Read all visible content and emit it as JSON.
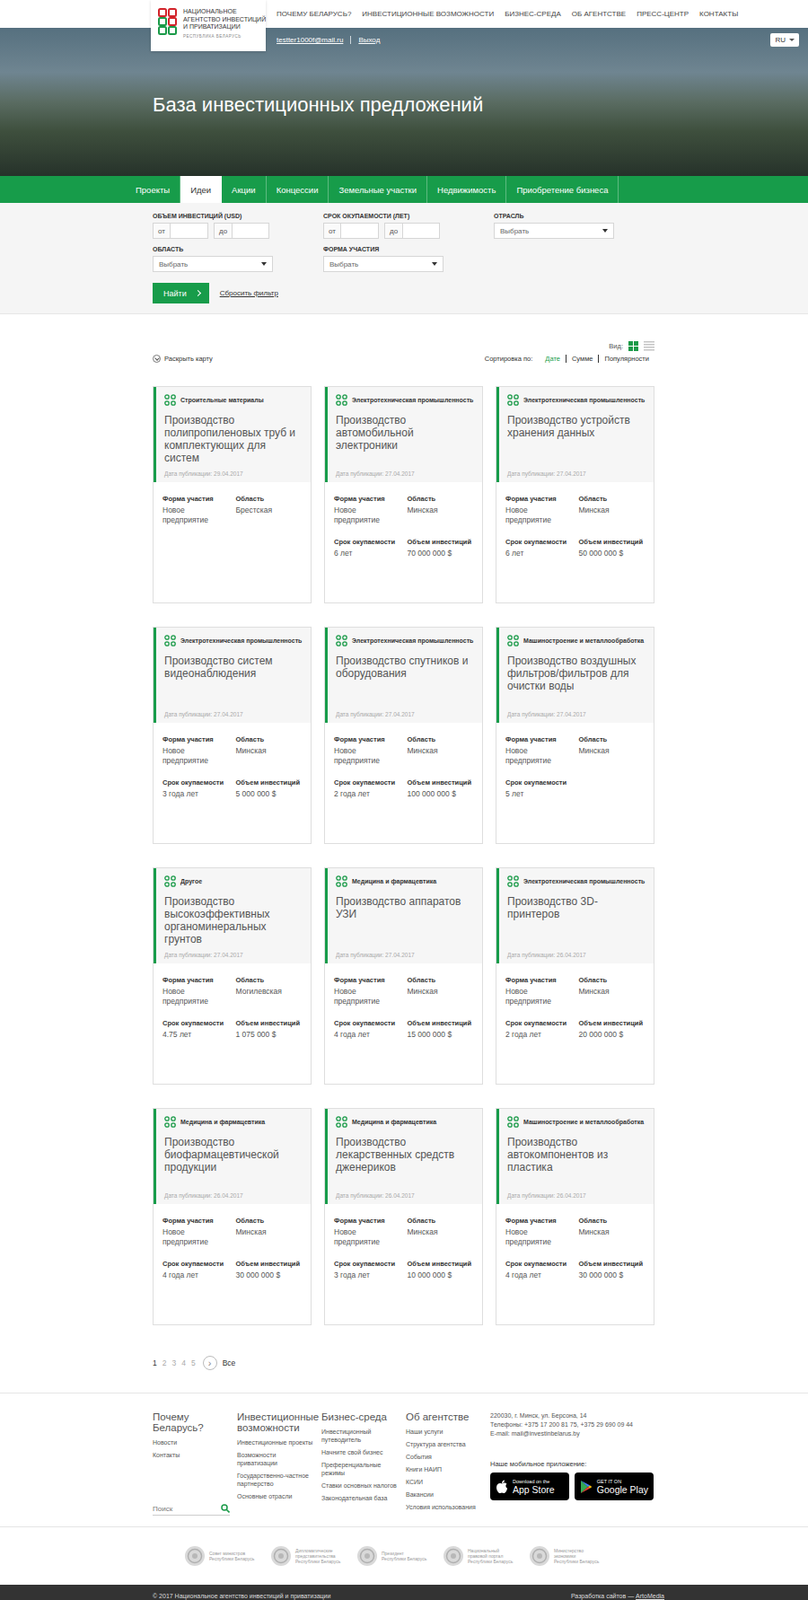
{
  "header": {
    "logo": {
      "lines": [
        "НАЦИОНАЛЬНОЕ",
        "АГЕНТСТВО ИНВЕСТИЦИЙ",
        "И ПРИВАТИЗАЦИИ"
      ],
      "sub": "РЕСПУБЛИКА БЕЛАРУСЬ"
    },
    "nav": [
      "ПОЧЕМУ БЕЛАРУСЬ?",
      "ИНВЕСТИЦИОННЫЕ ВОЗМОЖНОСТИ",
      "БИЗНЕС-СРЕДА",
      "ОБ АГЕНТСТВЕ",
      "ПРЕСС-ЦЕНТР",
      "КОНТАКТЫ"
    ]
  },
  "hero": {
    "email": "testter1000f@mail.ru",
    "logout": "Выход",
    "lang": "RU",
    "title": "База инвестиционных предложений"
  },
  "tabs": [
    {
      "label": "Проекты",
      "selected": false
    },
    {
      "label": "Идеи",
      "selected": true
    },
    {
      "label": "Акции",
      "selected": false
    },
    {
      "label": "Концессии",
      "selected": false
    },
    {
      "label": "Земельные участки",
      "selected": false
    },
    {
      "label": "Недвижимость",
      "selected": false
    },
    {
      "label": "Приобретение бизнеса",
      "selected": false
    }
  ],
  "filters": [
    {
      "label": "ОБЪЕМ ИНВЕСТИЦИЙ (USD)",
      "kind": "range",
      "from": "от",
      "to": "до"
    },
    {
      "label": "СРОК ОКУПАЕМОСТИ (ЛЕТ)",
      "kind": "range",
      "from": "от",
      "to": "до"
    },
    {
      "label": "ОТРАСЛЬ",
      "kind": "select",
      "placeholder": "Выбрать"
    },
    {
      "label": "ОБЛАСТЬ",
      "kind": "select",
      "placeholder": "Выбрать"
    },
    {
      "label": "ФОРМА УЧАСТИЯ",
      "kind": "select",
      "placeholder": "Выбрать"
    }
  ],
  "find_button": "Найти",
  "reset_link": "Сбросить фильтр",
  "map_toggle": "Раскрыть карту",
  "view": {
    "label": "Вид:",
    "modes": [
      {
        "kind": "grid",
        "selected": true
      },
      {
        "kind": "list",
        "selected": false
      }
    ]
  },
  "sort": {
    "label": "Сортировка по:",
    "options": [
      {
        "label": "Дате",
        "selected": true
      },
      {
        "label": "Сумме",
        "selected": false
      },
      {
        "label": "Популярности",
        "selected": false
      }
    ]
  },
  "cards": [
    {
      "category": "Строительные материалы",
      "title": "Производство полипропиленовых труб и комплектующих для систем",
      "date": "Дата публикации: 29.04.2017",
      "fields": [
        {
          "label": "Форма участия",
          "value": "Новое предприятие"
        },
        {
          "label": "Область",
          "value": "Брестская"
        }
      ]
    },
    {
      "category": "Электротехническая промышленность",
      "title": "Производство автомобильной электроники",
      "date": "Дата публикации: 27.04.2017",
      "fields": [
        {
          "label": "Форма участия",
          "value": "Новое предприятие"
        },
        {
          "label": "Область",
          "value": "Минская"
        },
        {
          "label": "Срок окупаемости",
          "value": "6 лет"
        },
        {
          "label": "Объем инвестиций",
          "value": "70 000 000 $"
        }
      ]
    },
    {
      "category": "Электротехническая промышленность",
      "title": "Производство устройств хранения данных",
      "date": "Дата публикации: 27.04.2017",
      "fields": [
        {
          "label": "Форма участия",
          "value": "Новое предприятие"
        },
        {
          "label": "Область",
          "value": "Минская"
        },
        {
          "label": "Срок окупаемости",
          "value": "6 лет"
        },
        {
          "label": "Объем инвестиций",
          "value": "50 000 000 $"
        }
      ]
    },
    {
      "category": "Электротехническая промышленность",
      "title": "Производство систем видеонаблюдения",
      "date": "Дата публикации: 27.04.2017",
      "fields": [
        {
          "label": "Форма участия",
          "value": "Новое предприятие"
        },
        {
          "label": "Область",
          "value": "Минская"
        },
        {
          "label": "Срок окупаемости",
          "value": "3 года лет"
        },
        {
          "label": "Объем инвестиций",
          "value": "5 000 000 $"
        }
      ]
    },
    {
      "category": "Электротехническая промышленность",
      "title": "Производство спутников и оборудования",
      "date": "Дата публикации: 27.04.2017",
      "fields": [
        {
          "label": "Форма участия",
          "value": "Новое предприятие"
        },
        {
          "label": "Область",
          "value": "Минская"
        },
        {
          "label": "Срок окупаемости",
          "value": "2 года лет"
        },
        {
          "label": "Объем инвестиций",
          "value": "100 000 000 $"
        }
      ]
    },
    {
      "category": "Машиностроение и металлообработка",
      "title": "Производство воздушных фильтров/фильтров для очистки воды",
      "date": "Дата публикации: 27.04.2017",
      "fields": [
        {
          "label": "Форма участия",
          "value": "Новое предприятие"
        },
        {
          "label": "Область",
          "value": "Минская"
        },
        {
          "label": "Срок окупаемости",
          "value": "5 лет"
        }
      ]
    },
    {
      "category": "Другое",
      "title": "Производство высокоэффективных органоминеральных грунтов",
      "date": "Дата публикации: 27.04.2017",
      "fields": [
        {
          "label": "Форма участия",
          "value": "Новое предприятие"
        },
        {
          "label": "Область",
          "value": "Могилевская"
        },
        {
          "label": "Срок окупаемости",
          "value": "4.75 лет"
        },
        {
          "label": "Объем инвестиций",
          "value": "1 075 000 $"
        }
      ]
    },
    {
      "category": "Медицина и фармацевтика",
      "title": "Производство аппаратов УЗИ",
      "date": "Дата публикации: 27.04.2017",
      "fields": [
        {
          "label": "Форма участия",
          "value": "Новое предприятие"
        },
        {
          "label": "Область",
          "value": "Минская"
        },
        {
          "label": "Срок окупаемости",
          "value": "4 года лет"
        },
        {
          "label": "Объем инвестиций",
          "value": "15 000 000 $"
        }
      ]
    },
    {
      "category": "Электротехническая промышленность",
      "title": "Производство 3D-принтеров",
      "date": "Дата публикации: 26.04.2017",
      "fields": [
        {
          "label": "Форма участия",
          "value": "Новое предприятие"
        },
        {
          "label": "Область",
          "value": "Минская"
        },
        {
          "label": "Срок окупаемости",
          "value": "2 года лет"
        },
        {
          "label": "Объем инвестиций",
          "value": "20 000 000 $"
        }
      ]
    },
    {
      "category": "Медицина и фармацевтика",
      "title": "Производство биофармацевтической продукции",
      "date": "Дата публикации: 26.04.2017",
      "fields": [
        {
          "label": "Форма участия",
          "value": "Новое предприятие"
        },
        {
          "label": "Область",
          "value": "Минская"
        },
        {
          "label": "Срок окупаемости",
          "value": "4 года лет"
        },
        {
          "label": "Объем инвестиций",
          "value": "30 000 000 $"
        }
      ]
    },
    {
      "category": "Медицина и фармацевтика",
      "title": "Производство лекарственных средств дженериков",
      "date": "Дата публикации: 26.04.2017",
      "fields": [
        {
          "label": "Форма участия",
          "value": "Новое предприятие"
        },
        {
          "label": "Область",
          "value": "Минская"
        },
        {
          "label": "Срок окупаемости",
          "value": "3 года лет"
        },
        {
          "label": "Объем инвестиций",
          "value": "10 000 000 $"
        }
      ]
    },
    {
      "category": "Машиностроение и металлообработка",
      "title": "Производство автокомпонентов из пластика",
      "date": "Дата публикации: 26.04.2017",
      "fields": [
        {
          "label": "Форма участия",
          "value": "Новое предприятие"
        },
        {
          "label": "Область",
          "value": "Минская"
        },
        {
          "label": "Срок окупаемости",
          "value": "4 года лет"
        },
        {
          "label": "Объем инвестиций",
          "value": "30 000 000 $"
        }
      ]
    }
  ],
  "pagination": {
    "pages": [
      {
        "label": "1",
        "selected": true
      },
      {
        "label": "2",
        "selected": false
      },
      {
        "label": "3",
        "selected": false
      },
      {
        "label": "4",
        "selected": false
      },
      {
        "label": "5",
        "selected": false
      }
    ],
    "next": "›",
    "all": "Все"
  },
  "footer": {
    "columns": [
      {
        "title": "Почему Беларусь?",
        "items": [
          "Новости",
          "Контакты"
        ]
      },
      {
        "title": "Инвестиционные возможности",
        "items": [
          "Инвестиционные проекты",
          "Возможности приватизации",
          "Государственно-частное партнерство",
          "Основные отрасли"
        ]
      },
      {
        "title": "Бизнес-среда",
        "items": [
          "Инвестиционный путеводитель",
          "Начните свой бизнес",
          "Преференциальные режимы",
          "Ставки основных налогов",
          "Законодательная база"
        ]
      },
      {
        "title": "Об агентстве",
        "items": [
          "Наши услуги",
          "Структура агентства",
          "События",
          "Книги НАИП",
          "КСИИ",
          "Вакансии",
          "Условия использования"
        ]
      }
    ],
    "search_placeholder": "Поиск",
    "contacts": [
      "220030, г. Минск, ул. Берсона, 14",
      "Телефоны: +375 17 200 81 75, +375 29 690 09 44",
      "E-mail: mail@investinbelarus.by"
    ],
    "apps_label": "Наше мобильное приложение:",
    "apps": [
      {
        "kind": "apple",
        "small": "Download on the",
        "big": "App Store"
      },
      {
        "kind": "google",
        "small": "GET IT ON",
        "big": "Google Play"
      }
    ]
  },
  "partners": [
    {
      "lines": [
        "Совет министров",
        "Республики Беларусь"
      ]
    },
    {
      "lines": [
        "Дипломатические",
        "представительства",
        "Республики Беларусь"
      ]
    },
    {
      "lines": [
        "Президент",
        "Республики Беларусь"
      ]
    },
    {
      "lines": [
        "Национальный",
        "правовой портал",
        "Республики Беларусь"
      ]
    },
    {
      "lines": [
        "Министерство",
        "экономики",
        "Республики Беларусь"
      ]
    }
  ],
  "bottom": {
    "copyright": "© 2017 Национальное агентство инвестиций и приватизации",
    "dev_label": "Разработка сайтов — ",
    "dev_link": "ArtoMedia"
  }
}
